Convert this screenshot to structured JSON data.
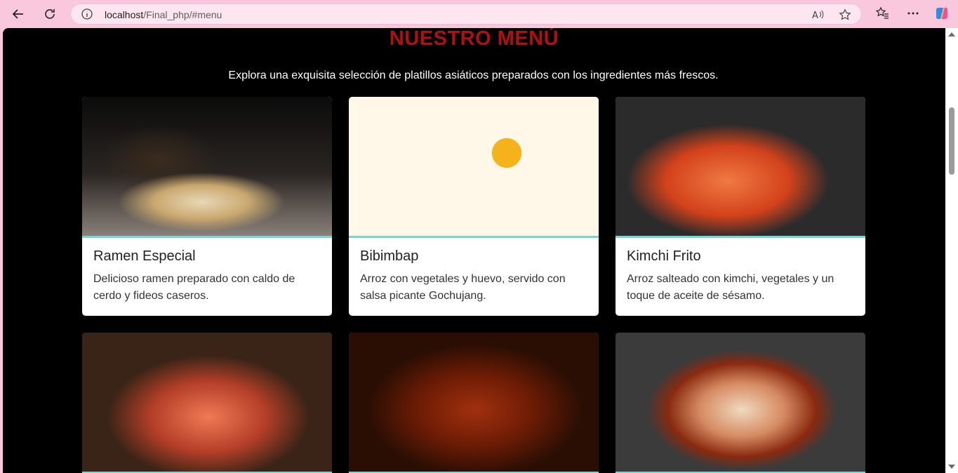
{
  "browser": {
    "url_host": "localhost",
    "url_path": "/Final_php/#menu"
  },
  "menu": {
    "title": "NUESTRO MENÚ",
    "subtitle": "Explora una exquisita selección de platillos asiáticos preparados con los ingredientes más frescos.",
    "items": [
      {
        "name": "Ramen Especial",
        "description": "Delicioso ramen preparado con caldo de cerdo y fideos caseros."
      },
      {
        "name": "Bibimbap",
        "description": "Arroz con vegetales y huevo, servido con salsa picante Gochujang."
      },
      {
        "name": "Kimchi Frito",
        "description": "Arroz salteado con kimchi, vegetales y un toque de aceite de sésamo."
      }
    ]
  },
  "colors": {
    "title": "#b01010",
    "background": "#000000",
    "accent_divider": "#7fd3cf",
    "browser_chrome": "#f9c8dc"
  }
}
